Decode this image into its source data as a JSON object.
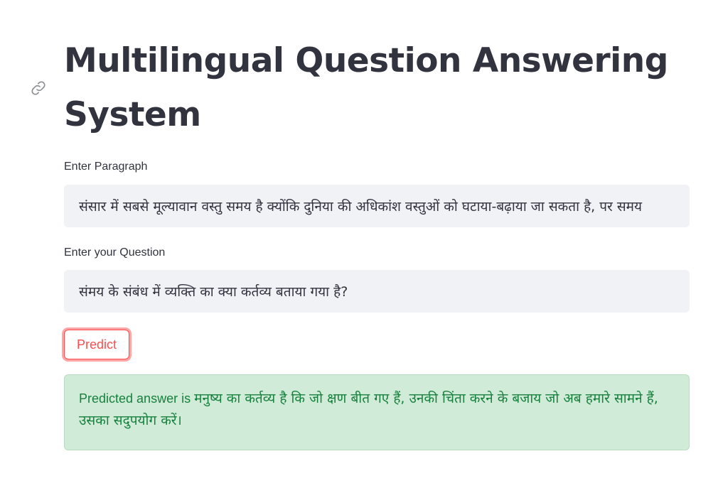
{
  "header": {
    "title": "Multilingual Question Answering System"
  },
  "paragraph_field": {
    "label": "Enter Paragraph",
    "value": "संसार में सबसे मूल्यावान वस्तु समय है क्योंकि दुनिया की अधिकांश वस्तुओं को घटाया-बढ़ाया जा सकता है, पर समय"
  },
  "question_field": {
    "label": "Enter your Question",
    "value": "संमय के संबंध में व्यक्ति का क्या कर्तव्य बताया गया है?"
  },
  "predict_button": {
    "label": "Predict",
    "accent_color": "#ff4b4b"
  },
  "result": {
    "prefix": "Predicted answer is ",
    "answer": "मनुष्य का कर्तव्य है कि जो क्षण बीत गए हैं, उनकी चिंता करने के बजाय जो अब हमारे सामने हैं, उसका सदुपयोग करें।",
    "color": "#17803d"
  },
  "icons": {
    "anchor": "link-icon"
  }
}
